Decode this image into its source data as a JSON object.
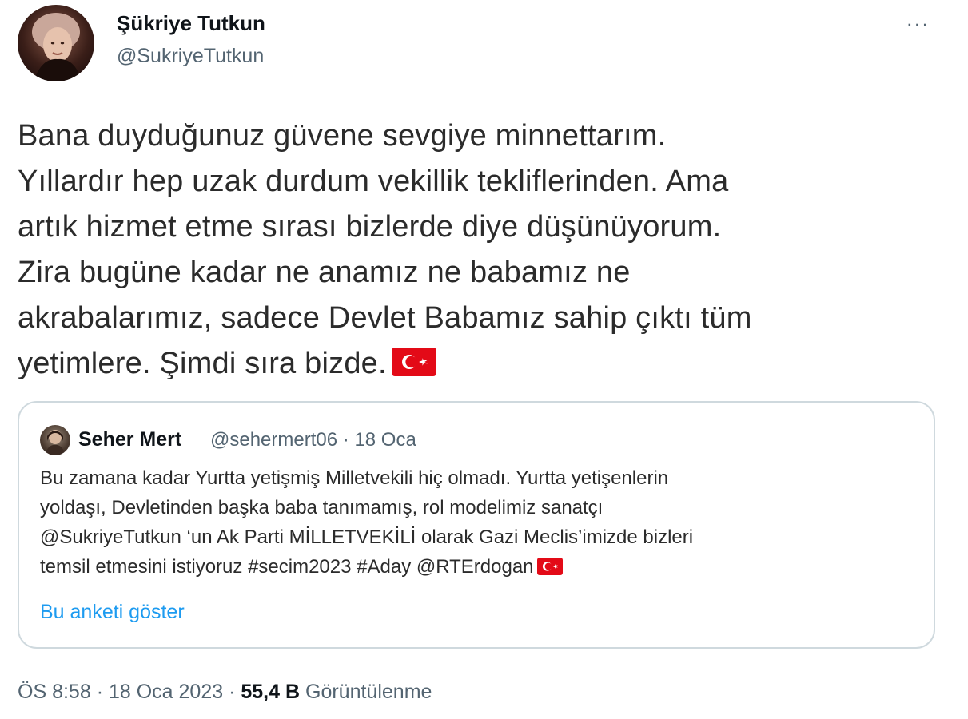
{
  "author": {
    "name": "Şükriye Tutkun",
    "handle": "@SukriyeTutkun"
  },
  "more_label": "···",
  "tweet_text_lines": [
    "Bana duyduğunuz güvene sevgiye minnettarım.",
    "Yıllardır hep uzak durdum vekillik tekliflerinden. Ama",
    "artık hizmet etme sırası bizlerde diye düşünüyorum.",
    "Zira bugüne kadar ne anamız ne babamız ne",
    "akrabalarımız, sadece Devlet Babamız sahip çıktı tüm",
    "yetimlere. Şimdi sıra bizde."
  ],
  "quote": {
    "author_name": "Seher Mert",
    "author_handle": "@sehermert06",
    "separator": "·",
    "date": "18 Oca",
    "text_lines": [
      "Bu zamana kadar Yurtta yetişmiş Milletvekili hiç olmadı. Yurtta yetişenlerin",
      "yoldaşı, Devletinden başka baba tanımamış, rol modelimiz sanatçı",
      "@SukriyeTutkun ‘un Ak Parti MİLLETVEKİLİ olarak  Gazi Meclis’imizde bizleri",
      "temsil etmesini istiyoruz #secim2023 #Aday @RTErdogan"
    ],
    "show_poll_label": "Bu anketi göster"
  },
  "footer": {
    "time": "ÖS 8:58",
    "separator": "·",
    "date": "18 Oca 2023",
    "views_count": "55,4 B",
    "views_label": "Görüntülenme"
  },
  "colors": {
    "text": "#0f1419",
    "secondary": "#536471",
    "link": "#1d9bf0",
    "border": "#cfd9de",
    "flag_red": "#e30a17"
  },
  "icons": {
    "flag": "turkey-flag-icon",
    "more": "more-options-icon"
  }
}
